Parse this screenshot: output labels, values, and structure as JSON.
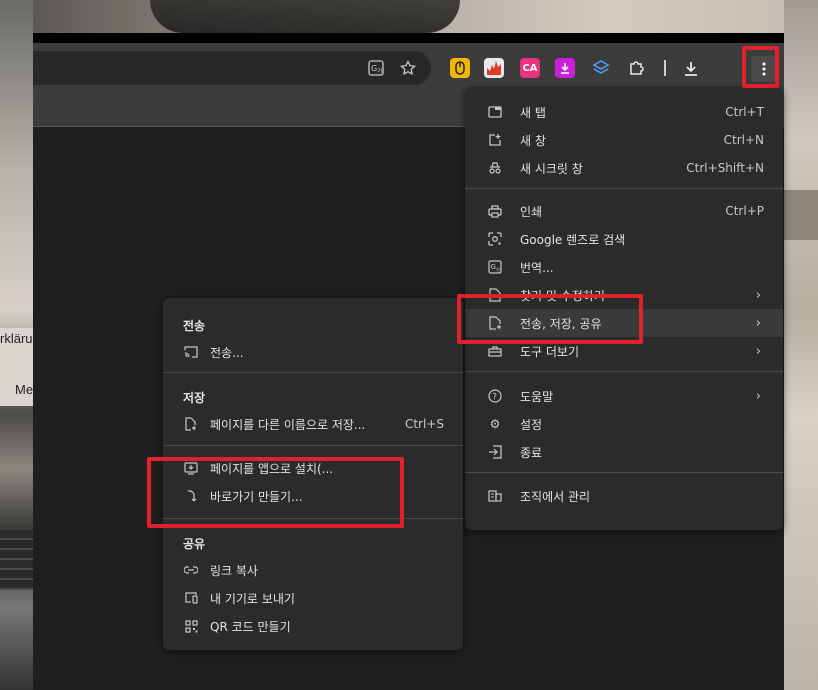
{
  "background_text": {
    "left_top": "rkläru",
    "left_bottom": "Me"
  },
  "toolbar": {
    "icons": [
      "translate-icon",
      "star-icon",
      "ext-yellow-icon",
      "ext-fire-icon",
      "ext-ca-icon",
      "ext-download-purple-icon",
      "ext-layers-icon",
      "puzzle-icon",
      "download-icon",
      "kebab-menu-icon"
    ],
    "ext_ca_label": "CA"
  },
  "main_menu": {
    "new_tab": {
      "label": "새 탭",
      "shortcut": "Ctrl+T"
    },
    "new_window": {
      "label": "새 창",
      "shortcut": "Ctrl+N"
    },
    "incognito": {
      "label": "새 시크릿 창",
      "shortcut": "Ctrl+Shift+N"
    },
    "print": {
      "label": "인쇄",
      "shortcut": "Ctrl+P"
    },
    "lens": {
      "label": "Google 렌즈로 검색"
    },
    "translate": {
      "label": "번역..."
    },
    "find_edit": {
      "label": "찾기 및 수정하기"
    },
    "cast_save_share": {
      "label": "전송, 저장, 공유"
    },
    "more_tools": {
      "label": "도구 더보기"
    },
    "help": {
      "label": "도움말"
    },
    "settings": {
      "label": "설정"
    },
    "exit": {
      "label": "종료"
    },
    "managed": {
      "label": "조직에서 관리"
    }
  },
  "sub_menu": {
    "cast_header": "전송",
    "cast": {
      "label": "전송..."
    },
    "save_header": "저장",
    "save_as": {
      "label": "페이지를 다른 이름으로 저장...",
      "shortcut": "Ctrl+S"
    },
    "install_app": {
      "label": "페이지를 앱으로 설치(..."
    },
    "shortcut": {
      "label": "바로가기 만들기..."
    },
    "share_header": "공유",
    "copy_link": {
      "label": "링크 복사"
    },
    "send_devices": {
      "label": "내 기기로 보내기"
    },
    "qr": {
      "label": "QR 코드 만들기"
    }
  },
  "colors": {
    "highlight": "#e0202a",
    "menu_bg": "#2b2b2b",
    "toolbar_bg": "#3c3c3c"
  }
}
